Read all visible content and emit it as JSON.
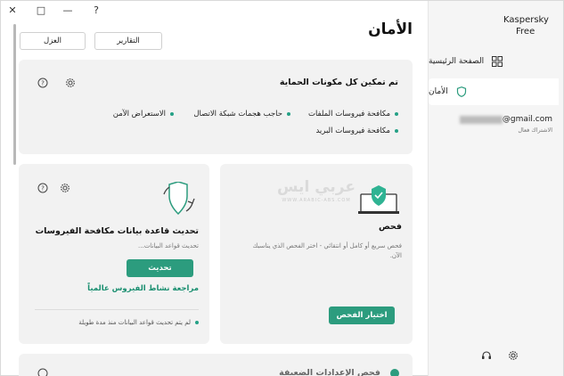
{
  "window": {
    "controls": [
      "?",
      "—",
      "□",
      "✕"
    ]
  },
  "sidebar": {
    "brand_line1": "Kaspersky",
    "brand_line2": "Free",
    "items": [
      {
        "label": "الصفحة الرئيسية",
        "icon": "grid-icon"
      },
      {
        "label": "الأمان",
        "icon": "shield-icon"
      }
    ],
    "account": {
      "email_suffix": "@gmail.com",
      "subscription": "الاشتراك فعال"
    }
  },
  "header": {
    "title": "الأمان",
    "reports_button": "التقارير",
    "quarantine_button": "العزل"
  },
  "protection_card": {
    "title": "تم تمكين كل مكونات الحماية",
    "components": [
      "مكافحة فيروسات الملفات",
      "حاجب هجمات شبكة الاتصال",
      "الاستعراض الآمن",
      "مكافحة فيروسات البريد"
    ]
  },
  "scan_card": {
    "title": "فحص",
    "description_line1": "فحص سريع أو كامل أو انتقائي - اختر الفحص الذي يناسبك",
    "description_line2": "الآن.",
    "button": "اختيار الفحص"
  },
  "update_card": {
    "title": "تحديث قاعدة بيانات مكافحة الفيروسات",
    "subtitle": "تحديث قواعد البيانات...",
    "button": "تحديث",
    "link": "مراجعة نشاط الفيروس عالمياً",
    "status": "لم يتم تحديث قواعد البيانات منذ مدة طويلة"
  },
  "bottom_card": {
    "title": "فحص الإعدادات الضعيفة"
  },
  "watermark": {
    "text": "عربي ايس",
    "sub": "WWW.ARABIC-ABS.COM"
  },
  "colors": {
    "accent": "#2c9c7e",
    "card_bg": "#f2f2f2",
    "sidebar_bg": "#f5f5f5"
  }
}
